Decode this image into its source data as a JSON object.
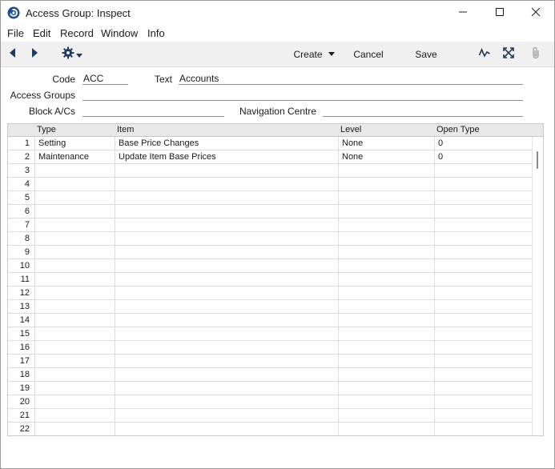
{
  "window": {
    "title": "Access Group: Inspect",
    "icons": [
      "app-logo-icon",
      "minimize-icon",
      "maximize-icon",
      "close-icon"
    ]
  },
  "menu": [
    "File",
    "Edit",
    "Record",
    "Window",
    "Info"
  ],
  "toolbar": {
    "create_label": "Create",
    "cancel_label": "Cancel",
    "save_label": "Save",
    "icons": [
      "back-arrow-icon",
      "forward-arrow-icon",
      "gear-icon",
      "dropdown-arrow-icon",
      "activity-icon",
      "expand-icon",
      "paperclip-icon"
    ]
  },
  "form": {
    "code_label": "Code",
    "code_value": "ACC",
    "text_label": "Text",
    "text_value": "Accounts",
    "access_groups_label": "Access Groups",
    "access_groups_value": "",
    "block_acs_label": "Block A/Cs",
    "block_acs_value": "",
    "navigation_centre_label": "Navigation Centre",
    "navigation_centre_value": ""
  },
  "grid": {
    "columns": [
      "Type",
      "Item",
      "Level",
      "Open Type"
    ],
    "rows": [
      {
        "num": "1",
        "type": "Setting",
        "item": "Base Price Changes",
        "level": "None",
        "open": "0"
      },
      {
        "num": "2",
        "type": "Maintenance",
        "item": "Update Item Base Prices",
        "level": "None",
        "open": "0"
      },
      {
        "num": "3",
        "type": "",
        "item": "",
        "level": "",
        "open": ""
      },
      {
        "num": "4",
        "type": "",
        "item": "",
        "level": "",
        "open": ""
      },
      {
        "num": "5",
        "type": "",
        "item": "",
        "level": "",
        "open": ""
      },
      {
        "num": "6",
        "type": "",
        "item": "",
        "level": "",
        "open": ""
      },
      {
        "num": "7",
        "type": "",
        "item": "",
        "level": "",
        "open": ""
      },
      {
        "num": "8",
        "type": "",
        "item": "",
        "level": "",
        "open": ""
      },
      {
        "num": "9",
        "type": "",
        "item": "",
        "level": "",
        "open": ""
      },
      {
        "num": "10",
        "type": "",
        "item": "",
        "level": "",
        "open": ""
      },
      {
        "num": "11",
        "type": "",
        "item": "",
        "level": "",
        "open": ""
      },
      {
        "num": "12",
        "type": "",
        "item": "",
        "level": "",
        "open": ""
      },
      {
        "num": "13",
        "type": "",
        "item": "",
        "level": "",
        "open": ""
      },
      {
        "num": "14",
        "type": "",
        "item": "",
        "level": "",
        "open": ""
      },
      {
        "num": "15",
        "type": "",
        "item": "",
        "level": "",
        "open": ""
      },
      {
        "num": "16",
        "type": "",
        "item": "",
        "level": "",
        "open": ""
      },
      {
        "num": "17",
        "type": "",
        "item": "",
        "level": "",
        "open": ""
      },
      {
        "num": "18",
        "type": "",
        "item": "",
        "level": "",
        "open": ""
      },
      {
        "num": "19",
        "type": "",
        "item": "",
        "level": "",
        "open": ""
      },
      {
        "num": "20",
        "type": "",
        "item": "",
        "level": "",
        "open": ""
      },
      {
        "num": "21",
        "type": "",
        "item": "",
        "level": "",
        "open": ""
      },
      {
        "num": "22",
        "type": "",
        "item": "",
        "level": "",
        "open": ""
      }
    ]
  }
}
